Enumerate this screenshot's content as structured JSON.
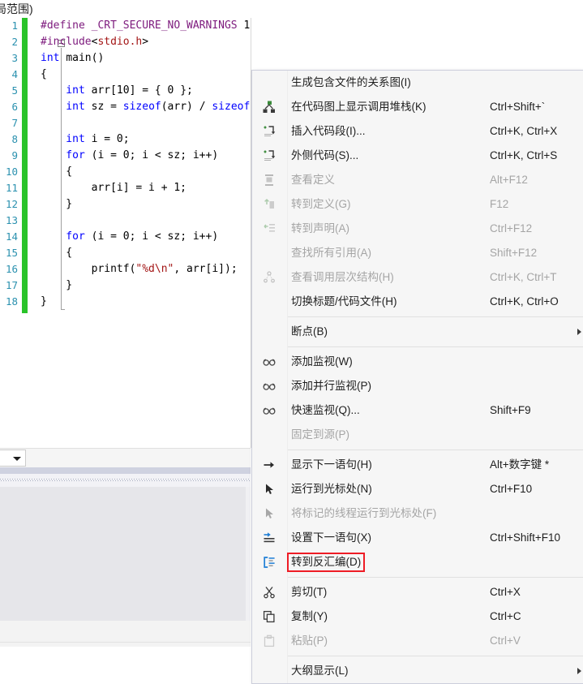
{
  "window": {
    "caption": "局范围)"
  },
  "editor": {
    "language": "c",
    "lines": [
      {
        "n": "1",
        "segments": [
          {
            "t": "#define ",
            "c": "pp"
          },
          {
            "t": "_CRT_SECURE_NO_WARNINGS ",
            "c": "pp"
          },
          {
            "t": "1",
            "c": "plain"
          }
        ]
      },
      {
        "n": "2",
        "segments": [
          {
            "t": "#include",
            "c": "pp"
          },
          {
            "t": "<",
            "c": "plain"
          },
          {
            "t": "stdio.h",
            "c": "inc"
          },
          {
            "t": ">",
            "c": "plain"
          }
        ]
      },
      {
        "n": "3",
        "segments": [
          {
            "t": "int ",
            "c": "kw"
          },
          {
            "t": "main()",
            "c": "plain"
          }
        ]
      },
      {
        "n": "4",
        "segments": [
          {
            "t": "{",
            "c": "plain"
          }
        ]
      },
      {
        "n": "5",
        "segments": [
          {
            "t": "    int ",
            "c": "kw"
          },
          {
            "t": "arr[10] = { 0 };",
            "c": "plain"
          }
        ]
      },
      {
        "n": "6",
        "segments": [
          {
            "t": "    int ",
            "c": "kw"
          },
          {
            "t": "sz = ",
            "c": "plain"
          },
          {
            "t": "sizeof",
            "c": "kw"
          },
          {
            "t": "(arr) / ",
            "c": "plain"
          },
          {
            "t": "sizeof",
            "c": "kw"
          }
        ]
      },
      {
        "n": "7",
        "segments": [
          {
            "t": "",
            "c": "plain"
          }
        ]
      },
      {
        "n": "8",
        "segments": [
          {
            "t": "    int ",
            "c": "kw"
          },
          {
            "t": "i = 0;",
            "c": "plain"
          }
        ]
      },
      {
        "n": "9",
        "segments": [
          {
            "t": "    for ",
            "c": "kw"
          },
          {
            "t": "(i = 0; i < sz; i++)",
            "c": "plain"
          }
        ]
      },
      {
        "n": "10",
        "segments": [
          {
            "t": "    {",
            "c": "plain"
          }
        ]
      },
      {
        "n": "11",
        "segments": [
          {
            "t": "        arr[i] = i + 1;",
            "c": "plain"
          }
        ]
      },
      {
        "n": "12",
        "segments": [
          {
            "t": "    }",
            "c": "plain"
          }
        ]
      },
      {
        "n": "13",
        "segments": [
          {
            "t": "",
            "c": "plain"
          }
        ]
      },
      {
        "n": "14",
        "segments": [
          {
            "t": "    for ",
            "c": "kw"
          },
          {
            "t": "(i = 0; i < sz; i++)",
            "c": "plain"
          }
        ]
      },
      {
        "n": "15",
        "segments": [
          {
            "t": "    {",
            "c": "plain"
          }
        ]
      },
      {
        "n": "16",
        "segments": [
          {
            "t": "        printf(",
            "c": "plain"
          },
          {
            "t": "\"%d\\n\"",
            "c": "str"
          },
          {
            "t": ", arr[i]);",
            "c": "plain"
          }
        ]
      },
      {
        "n": "17",
        "segments": [
          {
            "t": "    }",
            "c": "plain"
          }
        ]
      },
      {
        "n": "18",
        "segments": [
          {
            "t": "}",
            "c": "plain"
          }
        ]
      }
    ],
    "colors": {
      "keyword": "#0000ff",
      "preprocessor": "#7d1a7d",
      "string": "#a31515",
      "line_number": "#2b91af",
      "change_bar": "#29c329"
    }
  },
  "context_menu": {
    "highlight_color": "#ee1c25",
    "items": [
      {
        "id": "generate-include-graph",
        "icon": "none",
        "label": "生成包含文件的关系图(I)",
        "accel": "",
        "disabled": false,
        "submenu": false,
        "highlighted": false,
        "separator_after": false
      },
      {
        "id": "show-call-stack-on-code-map",
        "icon": "code-map-icon",
        "label": "在代码图上显示调用堆栈(K)",
        "accel": "Ctrl+Shift+`",
        "disabled": false,
        "submenu": false,
        "highlighted": false,
        "separator_after": false
      },
      {
        "id": "insert-snippet",
        "icon": "insert-snippet-icon",
        "label": "插入代码段(I)...",
        "accel": "Ctrl+K, Ctrl+X",
        "disabled": false,
        "submenu": false,
        "highlighted": false,
        "separator_after": false
      },
      {
        "id": "surround-with",
        "icon": "surround-with-icon",
        "label": "外侧代码(S)...",
        "accel": "Ctrl+K, Ctrl+S",
        "disabled": false,
        "submenu": false,
        "highlighted": false,
        "separator_after": false
      },
      {
        "id": "peek-definition",
        "icon": "peek-definition-icon",
        "label": "查看定义",
        "accel": "Alt+F12",
        "disabled": true,
        "submenu": false,
        "highlighted": false,
        "separator_after": false
      },
      {
        "id": "go-to-definition",
        "icon": "go-to-definition-icon",
        "label": "转到定义(G)",
        "accel": "F12",
        "disabled": true,
        "submenu": false,
        "highlighted": false,
        "separator_after": false
      },
      {
        "id": "go-to-declaration",
        "icon": "go-to-declaration-icon",
        "label": "转到声明(A)",
        "accel": "Ctrl+F12",
        "disabled": true,
        "submenu": false,
        "highlighted": false,
        "separator_after": false
      },
      {
        "id": "find-all-references",
        "icon": "none",
        "label": "查找所有引用(A)",
        "accel": "Shift+F12",
        "disabled": true,
        "submenu": false,
        "highlighted": false,
        "separator_after": false
      },
      {
        "id": "view-call-hierarchy",
        "icon": "call-hierarchy-icon",
        "label": "查看调用层次结构(H)",
        "accel": "Ctrl+K, Ctrl+T",
        "disabled": true,
        "submenu": false,
        "highlighted": false,
        "separator_after": false
      },
      {
        "id": "toggle-header-code-file",
        "icon": "none",
        "label": "切换标题/代码文件(H)",
        "accel": "Ctrl+K, Ctrl+O",
        "disabled": false,
        "submenu": false,
        "highlighted": false,
        "separator_after": true
      },
      {
        "id": "breakpoint",
        "icon": "none",
        "label": "断点(B)",
        "accel": "",
        "disabled": false,
        "submenu": true,
        "highlighted": false,
        "separator_after": true
      },
      {
        "id": "add-watch",
        "icon": "glasses-icon",
        "label": "添加监视(W)",
        "accel": "",
        "disabled": false,
        "submenu": false,
        "highlighted": false,
        "separator_after": false
      },
      {
        "id": "add-parallel-watch",
        "icon": "glasses-icon",
        "label": "添加并行监视(P)",
        "accel": "",
        "disabled": false,
        "submenu": false,
        "highlighted": false,
        "separator_after": false
      },
      {
        "id": "quick-watch",
        "icon": "glasses-icon",
        "label": "快速监视(Q)...",
        "accel": "Shift+F9",
        "disabled": false,
        "submenu": false,
        "highlighted": false,
        "separator_after": false
      },
      {
        "id": "pin-to-source",
        "icon": "none",
        "label": "固定到源(P)",
        "accel": "",
        "disabled": true,
        "submenu": false,
        "highlighted": false,
        "separator_after": true
      },
      {
        "id": "show-next-statement",
        "icon": "arrow-right-icon",
        "label": "显示下一语句(H)",
        "accel": "Alt+数字键 *",
        "disabled": false,
        "submenu": false,
        "highlighted": false,
        "separator_after": false
      },
      {
        "id": "run-to-cursor",
        "icon": "cursor-arrow-icon",
        "label": "运行到光标处(N)",
        "accel": "Ctrl+F10",
        "disabled": false,
        "submenu": false,
        "highlighted": false,
        "separator_after": false
      },
      {
        "id": "run-flagged-threads-to-cursor",
        "icon": "cursor-arrow-icon",
        "label": "将标记的线程运行到光标处(F)",
        "accel": "",
        "disabled": true,
        "submenu": false,
        "highlighted": false,
        "separator_after": false
      },
      {
        "id": "set-next-statement",
        "icon": "set-next-statement-icon",
        "label": "设置下一语句(X)",
        "accel": "Ctrl+Shift+F10",
        "disabled": false,
        "submenu": false,
        "highlighted": false,
        "separator_after": false
      },
      {
        "id": "go-to-disassembly",
        "icon": "disassembly-icon",
        "label": "转到反汇编(D)",
        "accel": "",
        "disabled": false,
        "submenu": false,
        "highlighted": true,
        "separator_after": true
      },
      {
        "id": "cut",
        "icon": "scissors-icon",
        "label": "剪切(T)",
        "accel": "Ctrl+X",
        "disabled": false,
        "submenu": false,
        "highlighted": false,
        "separator_after": false
      },
      {
        "id": "copy",
        "icon": "copy-icon",
        "label": "复制(Y)",
        "accel": "Ctrl+C",
        "disabled": false,
        "submenu": false,
        "highlighted": false,
        "separator_after": false
      },
      {
        "id": "paste",
        "icon": "paste-icon",
        "label": "粘贴(P)",
        "accel": "Ctrl+V",
        "disabled": true,
        "submenu": false,
        "highlighted": false,
        "separator_after": true
      },
      {
        "id": "outlining",
        "icon": "none",
        "label": "大纲显示(L)",
        "accel": "",
        "disabled": false,
        "submenu": true,
        "highlighted": false,
        "separator_after": false
      }
    ]
  }
}
